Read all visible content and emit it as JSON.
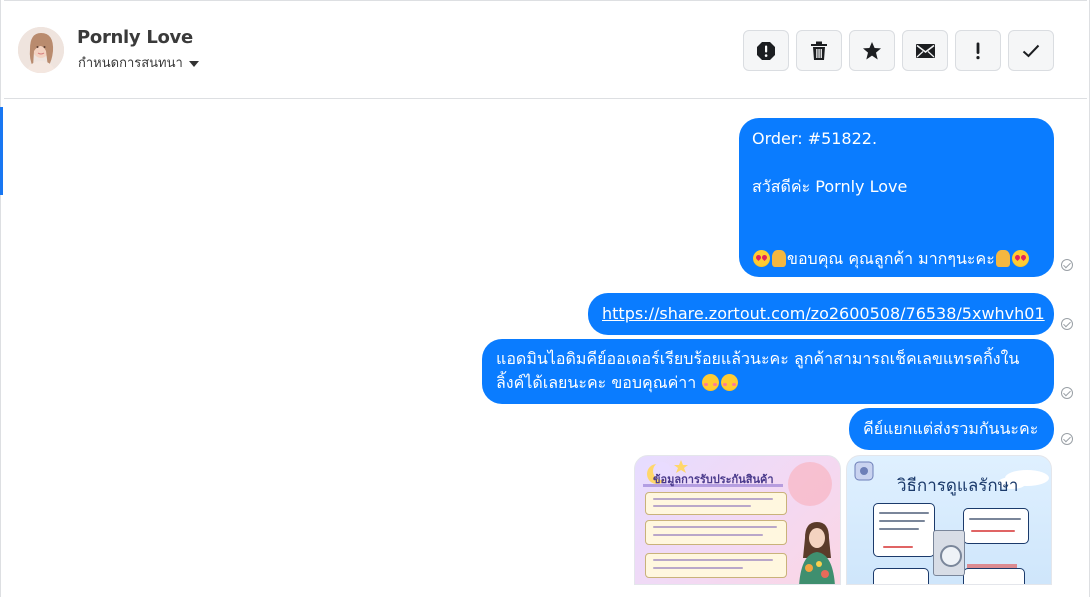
{
  "contact": {
    "name": "Pornly Love",
    "assign_label": "กำหนดการสนทนา"
  },
  "actions": [
    {
      "name": "spam",
      "icon": "alert-octagon-icon"
    },
    {
      "name": "delete",
      "icon": "trash-icon"
    },
    {
      "name": "star",
      "icon": "star-icon"
    },
    {
      "name": "mark-unread",
      "icon": "envelope-icon"
    },
    {
      "name": "important",
      "icon": "exclamation-icon"
    },
    {
      "name": "done",
      "icon": "check-icon"
    }
  ],
  "messages": {
    "m1_line1": "Order: #51822.",
    "m1_line2": "สวัสดีค่ะ Pornly Love",
    "m1_line3": "ขอบคุณ คุณลูกค้า มากๆนะคะ",
    "m2_link": "https://share.zortout.com/zo2600508/76538/5xwhvh01",
    "m3_line1": "แอดมินไอดิมคีย์ออเดอร์เรียบร้อยแล้วนะคะ ลูกค้าสามารถเช็คเลขแทรคกิ้งใน",
    "m3_line2": "ลิ้งค์ได้เลยนะคะ ขอบคุณค่าา",
    "m4": "คีย์แยกแต่ส่งรวมกันนะคะ"
  },
  "attachments": {
    "img1_title": "ข้อมูลการรับประกันสินค้า",
    "img2_title": "วิธีการดูแลรักษา"
  },
  "colors": {
    "bubble": "#0a7cff",
    "accent": "#1877f2"
  }
}
